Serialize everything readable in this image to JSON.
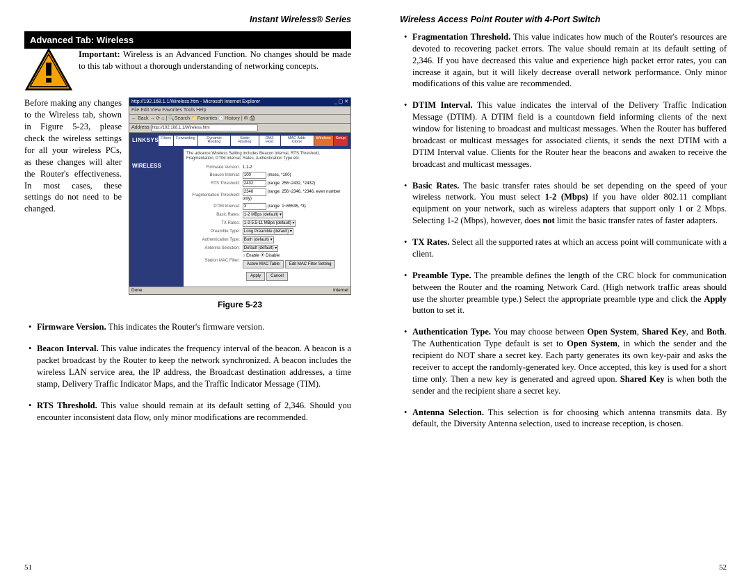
{
  "left": {
    "header": "Instant Wireless® Series",
    "section_title": "Advanced Tab: Wireless",
    "warning_text": "Wireless is an Advanced Function. No changes should be made to this tab without a thorough understanding of networking concepts.",
    "warning_label": "Important:",
    "intro_text": "Before making any changes to the Wireless tab, shown in Figure 5-23, please check the wireless settings for all your wireless PCs, as these changes will alter the Router's effectiveness. In most cases, these settings do not need to be changed.",
    "fig_caption": "Figure 5-23",
    "page_num": "51",
    "screenshot": {
      "title": "http://192.168.1.1/Wireless.htm - Microsoft Internet Explorer",
      "menubar": "File   Edit   View   Favorites   Tools   Help",
      "toolbar": "← Back  →   ⟳  ⌂  |  🔍Search  📁Favorites  🕓History  |  ✉  🖨",
      "address_label": "Address",
      "address_value": "http://192.168.1.1/Wireless.htm",
      "brand": "LINKSYS",
      "side_label": "WIRELESS",
      "note": "The advance Wireless Setting includes Beacon Interval, RTS Threshold, Fragmentation, DTIM interval, Rates, Authentication Type etc.",
      "tabs": [
        "Filters",
        "Forwarding",
        "Dynamic Routing",
        "Static Routing",
        "DMZ Host",
        "MAC Addr. Clone",
        "Wireless",
        "Setup"
      ],
      "rows": [
        {
          "label": "Firmware Version:",
          "value": "1.1-2",
          "type": "text"
        },
        {
          "label": "Beacon Interval:",
          "value": "100",
          "hint": "(msec, *100)",
          "type": "input"
        },
        {
          "label": "RTS Threshold:",
          "value": "2432",
          "hint": "(range: 256~2432, *2432)",
          "type": "input"
        },
        {
          "label": "Fragmentation Threshold:",
          "value": "2346",
          "hint": "(range: 256~2346, *2346, even number only)",
          "type": "input"
        },
        {
          "label": "DTIM Interval:",
          "value": "3",
          "hint": "(range: 1~65535, *3)",
          "type": "input"
        },
        {
          "label": "Basic Rates:",
          "value": "1-2 MBps (default)",
          "type": "select"
        },
        {
          "label": "TX Rates:",
          "value": "1-2-5.5-11 MBps (default)",
          "type": "select"
        },
        {
          "label": "Preamble Type:",
          "value": "Long Preamble (default)",
          "type": "select"
        },
        {
          "label": "Authentication Type:",
          "value": "Both (default)",
          "type": "select"
        },
        {
          "label": "Antenna Selection:",
          "value": "Default (default)",
          "type": "select"
        },
        {
          "label": "Station MAC Filter:",
          "value": "",
          "type": "macfilter",
          "opts": [
            "Enable",
            "Disable"
          ],
          "btns": [
            "Active MAC Table",
            "Edit MAC Filter Setting"
          ]
        }
      ],
      "apply": "Apply",
      "cancel": "Cancel",
      "status_left": "Done",
      "status_right": "Internet"
    },
    "bullets": [
      {
        "term": "Firmware Version.",
        "text": "  This indicates the Router's firmware version."
      },
      {
        "term": "Beacon Interval.",
        "text": "  This value indicates the frequency interval of the beacon. A beacon is a packet broadcast by the Router to keep the network synchronized. A beacon includes the wireless LAN service area, the IP address, the Broadcast destination addresses, a time stamp, Delivery Traffic Indicator Maps, and the Traffic Indicator Message (TIM)."
      },
      {
        "term": "RTS Threshold.",
        "text": "  This value should remain at its default setting of 2,346. Should you encounter inconsistent data flow, only minor modifications are recommended."
      }
    ]
  },
  "right": {
    "header": "Wireless Access Point Router with 4-Port Switch",
    "page_num": "52",
    "bullets": [
      {
        "term": "Fragmentation Threshold.",
        "text": "  This value indicates how much of the Router's resources are devoted to recovering packet errors. The value should remain at its default setting of 2,346. If you have decreased this value and experience high packet error rates, you can increase it again, but it will likely decrease overall network performance. Only minor modifications of this value are recommended."
      },
      {
        "term": "DTIM Interval.",
        "text": "  This value indicates the interval of the Delivery Traffic Indication Message (DTIM). A DTIM field is a countdown field informing clients of the next window for listening to broadcast and multicast messages. When the Router has buffered broadcast or multicast messages for associated clients, it sends the next DTIM with a DTIM Interval value. Clients for the Router hear the beacons and awaken to receive the broadcast and multicast messages."
      },
      {
        "term": "Basic Rates.",
        "html": " The basic transfer rates should be set depending on the speed of your wireless network. You must select <b>1-2 (Mbps)</b> if you have older 802.11 compliant equipment on your network, such as wireless adapters that support only 1 or 2 Mbps. Selecting 1-2 (Mbps), however, does <b>not</b> limit the basic transfer rates of faster adapters."
      },
      {
        "term": "TX Rates.",
        "text": " Select all the supported rates at which an access point will communicate with a client."
      },
      {
        "term": "Preamble Type.",
        "html": " The preamble defines the length of the CRC block for communication between the Router and the roaming Network Card. (High network traffic areas should use the shorter preamble type.) Select the appropriate preamble type and click the <b>Apply</b> button to set it."
      },
      {
        "term": "Authentication Type.",
        "html": " You may choose between <b>Open System</b>, <b>Shared Key</b>, and <b>Both</b>.  The Authentication Type default is set to <b>Open System</b>, in which the sender and the recipient do NOT share a secret key. Each party generates its own key-pair and asks the receiver to accept the randomly-generated key.  Once accepted, this key is used for a short time only.  Then a new key is generated and agreed upon.  <b>Shared Key</b> is when both the sender and the recipient share a secret key."
      },
      {
        "term": "Antenna Selection.",
        "text": "  This selection is for choosing which antenna transmits data. By default, the Diversity Antenna selection, used to increase reception, is chosen."
      }
    ]
  }
}
